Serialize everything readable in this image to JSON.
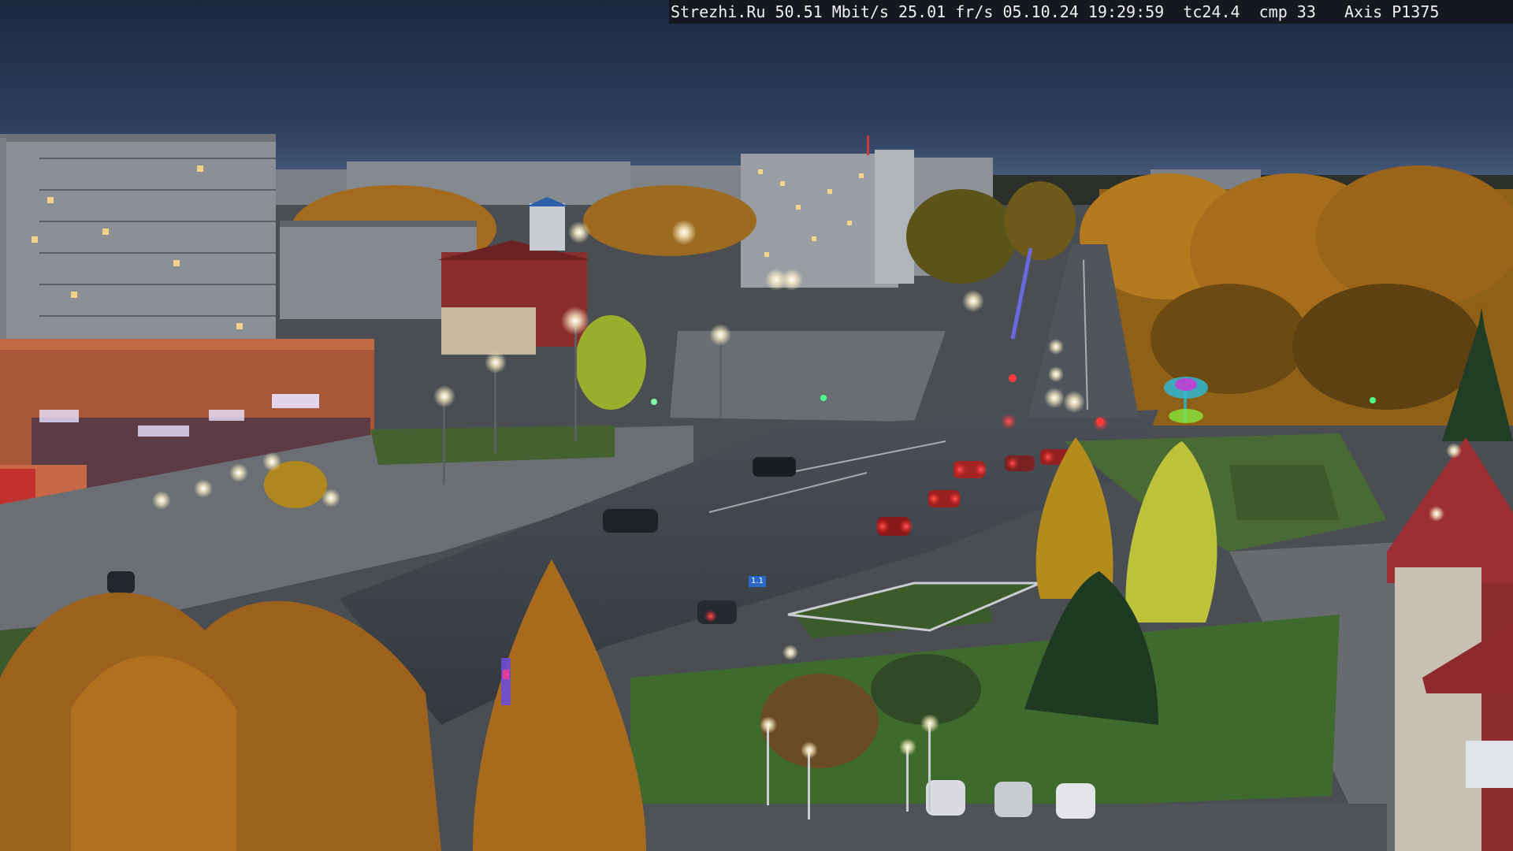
{
  "overlay": {
    "site": "Strezhi.Ru",
    "bitrate": "50.51 Mbit/s",
    "framerate": "25.01 fr/s",
    "date": "05.10.24",
    "time": "19:29:59",
    "tc": "tc24.4",
    "cmp": "cmp 33",
    "camera": "Axis P1375"
  },
  "signs": {
    "road_sign": "1.1"
  },
  "colors": {
    "sky_top": "#1f2b44",
    "sky_horizon": "#3a4f72",
    "asphalt": "#3b4046",
    "grass": "#3a5a2a",
    "autumn_tree": "#b3741e",
    "birch_yellow": "#c7c13a",
    "building_grey": "#7f848b",
    "building_red": "#8a2f2f",
    "lamp_glow": "#fff6d8"
  }
}
